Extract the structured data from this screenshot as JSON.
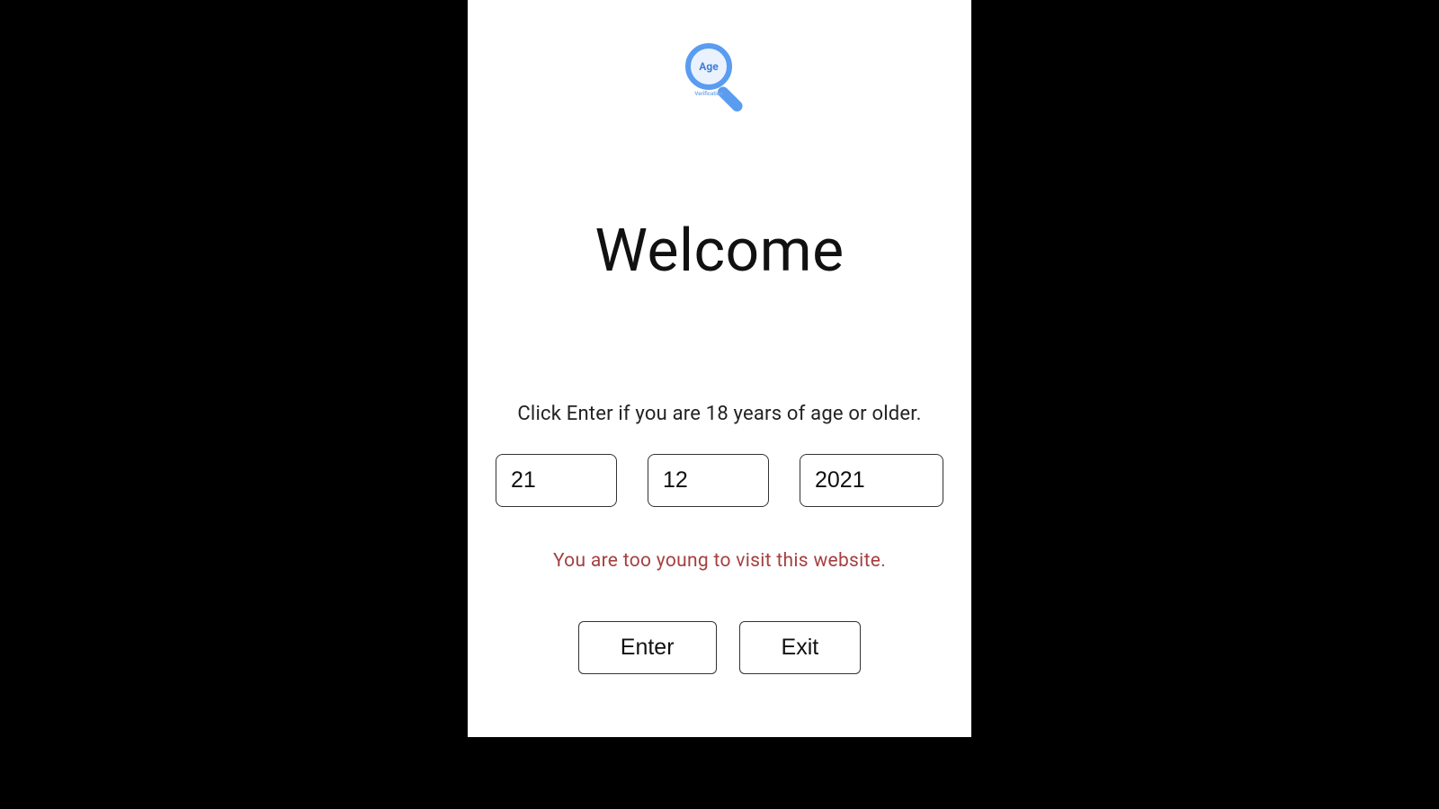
{
  "logo": {
    "text_main": "Age",
    "text_sub": "Verification"
  },
  "heading": "Welcome",
  "instructions": "Click Enter if you are 18 years of age or older.",
  "date": {
    "day": "21",
    "month": "12",
    "year": "2021"
  },
  "error_message": "You are too young to visit this website.",
  "buttons": {
    "enter": "Enter",
    "exit": "Exit"
  },
  "colors": {
    "accent": "#5a9cf0",
    "error": "#a64040"
  }
}
